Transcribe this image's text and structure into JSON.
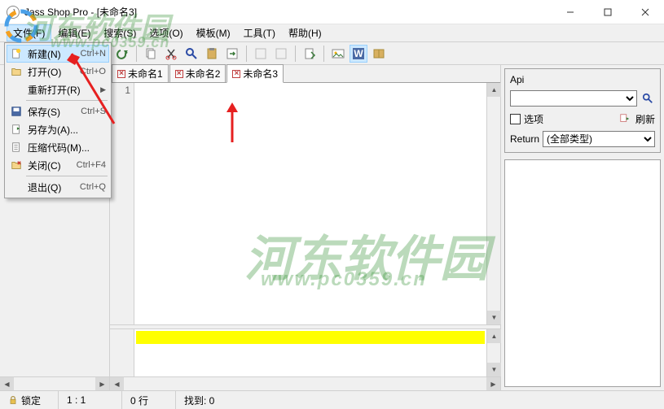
{
  "title": "Jass Shop Pro - [未命名3]",
  "menubar": [
    "文件(F)",
    "编辑(E)",
    "搜索(S)",
    "选项(O)",
    "模板(M)",
    "工具(T)",
    "帮助(H)"
  ],
  "file_menu": [
    {
      "icon": "new",
      "label": "新建(N)",
      "accel": "Ctrl+N",
      "hl": true
    },
    {
      "icon": "open",
      "label": "打开(O)",
      "accel": "Ctrl+O"
    },
    {
      "icon": "",
      "label": "重新打开(R)",
      "accel": "",
      "sub": true
    },
    {
      "sep": true
    },
    {
      "icon": "save",
      "label": "保存(S)",
      "accel": "Ctrl+S"
    },
    {
      "icon": "saveas",
      "label": "另存为(A)...",
      "accel": ""
    },
    {
      "icon": "compress",
      "label": "压缩代码(M)...",
      "accel": ""
    },
    {
      "icon": "close",
      "label": "关闭(C)",
      "accel": "Ctrl+F4"
    },
    {
      "sep": true
    },
    {
      "icon": "",
      "label": "退出(Q)",
      "accel": "Ctrl+Q"
    }
  ],
  "tabs": [
    {
      "label": "未命名1",
      "active": false
    },
    {
      "label": "未命名2",
      "active": false
    },
    {
      "label": "未命名3",
      "active": true
    }
  ],
  "gutter_lines": [
    "1"
  ],
  "api": {
    "title": "Api",
    "option_label": "选项",
    "refresh_label": "刷新",
    "return_label": "Return",
    "return_value": "(全部类型)"
  },
  "status": {
    "lock": "锁定",
    "pos": "1 : 1",
    "lines": "0 行",
    "found": "找到: 0"
  },
  "watermark": {
    "brand_cn": "河东软件园",
    "brand_url": "www.pc0359.cn"
  }
}
